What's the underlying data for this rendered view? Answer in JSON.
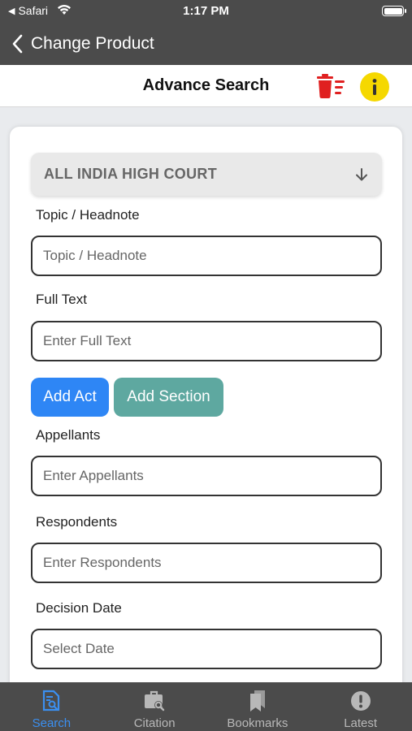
{
  "status_bar": {
    "back_app": "Safari",
    "time": "1:17 PM"
  },
  "nav": {
    "back_title": "Change Product"
  },
  "header": {
    "title": "Advance Search"
  },
  "form": {
    "court_select": "ALL INDIA HIGH COURT",
    "topic_label": "Topic / Headnote",
    "topic_placeholder": "Topic / Headnote",
    "fulltext_label": "Full Text",
    "fulltext_placeholder": "Enter Full Text",
    "add_act": "Add Act",
    "add_section": "Add Section",
    "appellants_label": "Appellants",
    "appellants_placeholder": "Enter Appellants",
    "respondents_label": "Respondents",
    "respondents_placeholder": "Enter Respondents",
    "decision_label": "Decision Date",
    "decision_placeholder": "Select Date"
  },
  "tabs": [
    {
      "label": "Search",
      "icon": "search-doc-icon",
      "active": true
    },
    {
      "label": "Citation",
      "icon": "briefcase-search-icon",
      "active": false
    },
    {
      "label": "Bookmarks",
      "icon": "bookmarks-icon",
      "active": false
    },
    {
      "label": "Latest",
      "icon": "alert-circle-icon",
      "active": false
    }
  ],
  "colors": {
    "bar_bg": "#4b4b4b",
    "accent_blue": "#2e86f5",
    "accent_teal": "#5ea8a0",
    "trash_red": "#e02020",
    "info_yellow": "#f5d800",
    "active_tab": "#3b8ff0"
  }
}
